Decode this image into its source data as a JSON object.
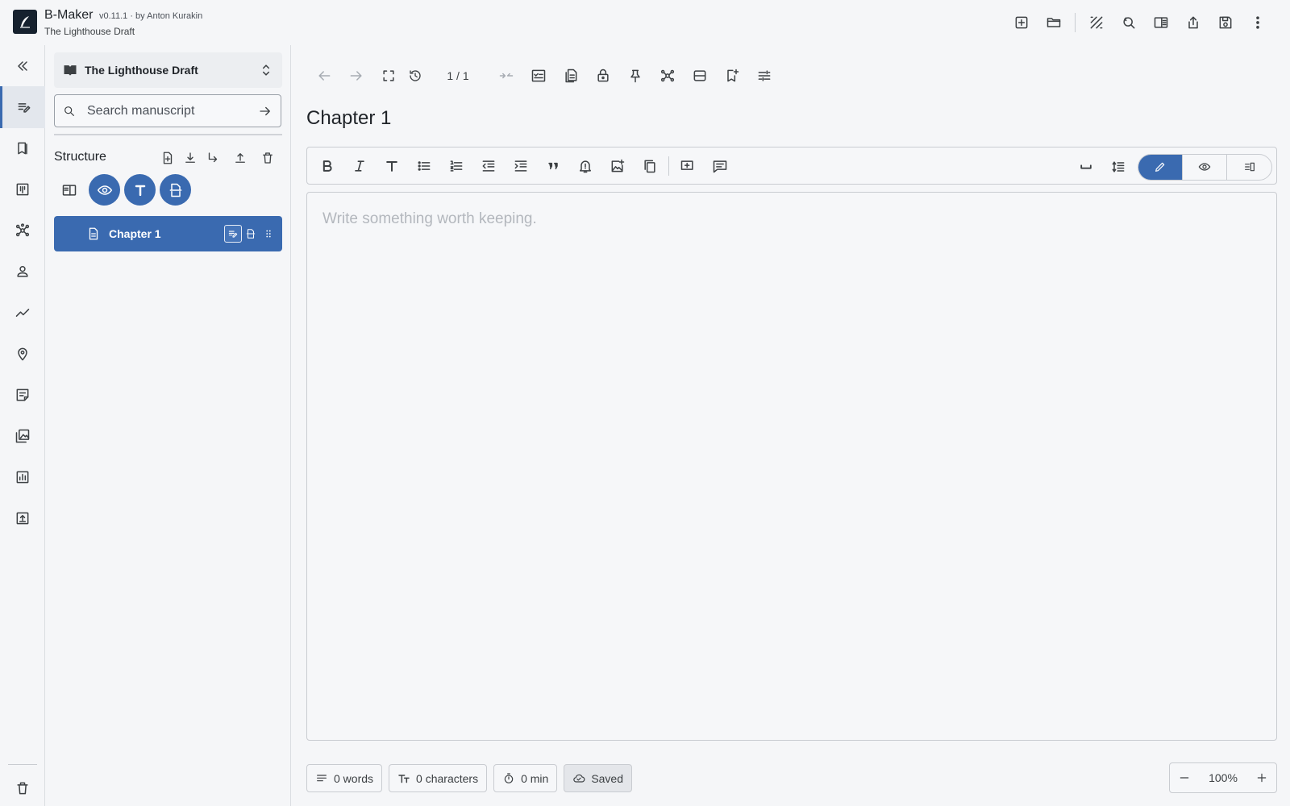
{
  "app": {
    "name": "B-Maker",
    "version": "v0.11.1 · by Anton Kurakin",
    "subtitle": "The Lighthouse Draft"
  },
  "top_actions": [
    "new-document-icon",
    "open-folder-icon",
    "texture-icon",
    "find-replace-icon",
    "split-view-icon",
    "export-icon",
    "save-icon",
    "more-vert-icon"
  ],
  "rail": {
    "items": [
      "collapse-icon",
      "manuscript-icon",
      "bookmarks-icon",
      "board-icon",
      "graph-icon",
      "character-icon",
      "timeline-icon",
      "location-icon",
      "notes-icon",
      "gallery-icon",
      "statistics-icon",
      "publish-icon"
    ],
    "active": "manuscript-icon",
    "bottom": "trash-icon"
  },
  "sidebar": {
    "project": "The Lighthouse Draft",
    "search_placeholder": "Search manuscript",
    "structure_title": "Structure",
    "tree": [
      {
        "label": "Chapter 1",
        "selected": true
      }
    ]
  },
  "main": {
    "page_counter": "1 / 1",
    "doc_title": "Chapter 1",
    "editor_placeholder": "Write something worth keeping.",
    "editor_value": "",
    "mode": "edit"
  },
  "status": {
    "words": "0 words",
    "characters": "0 characters",
    "time": "0 min",
    "saved": "Saved"
  },
  "zoom": {
    "value": "100%"
  },
  "colors": {
    "accent": "#3a6ab0",
    "background": "#f5f6f8",
    "border": "#c9ccd1"
  }
}
